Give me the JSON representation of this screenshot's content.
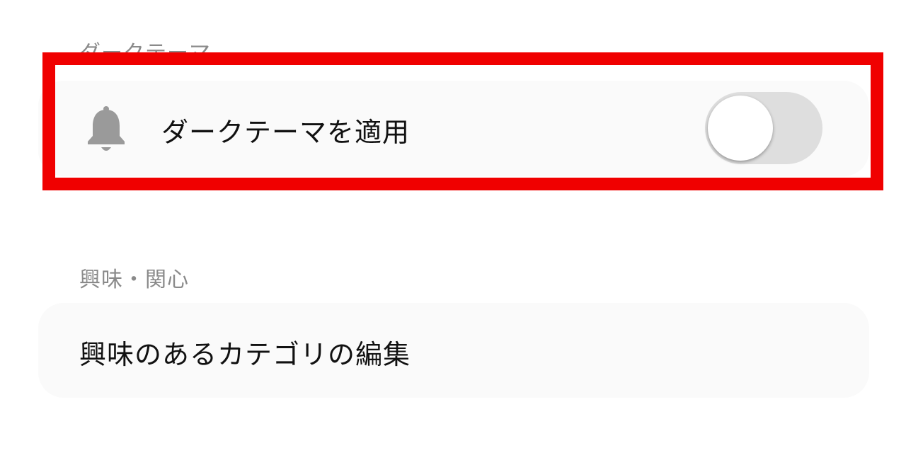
{
  "sections": {
    "dark_theme": {
      "label": "ダークテーマ",
      "row": {
        "icon": "bell-icon",
        "label": "ダークテーマを適用",
        "toggle_on": false
      }
    },
    "interests": {
      "label": "興味・関心",
      "row": {
        "label": "興味のあるカテゴリの編集"
      }
    }
  },
  "colors": {
    "highlight_border": "#f00000",
    "card_background": "#fafafa",
    "section_label": "#8a8a8a",
    "toggle_track_off": "#dedede",
    "icon": "#9a9a9a"
  }
}
